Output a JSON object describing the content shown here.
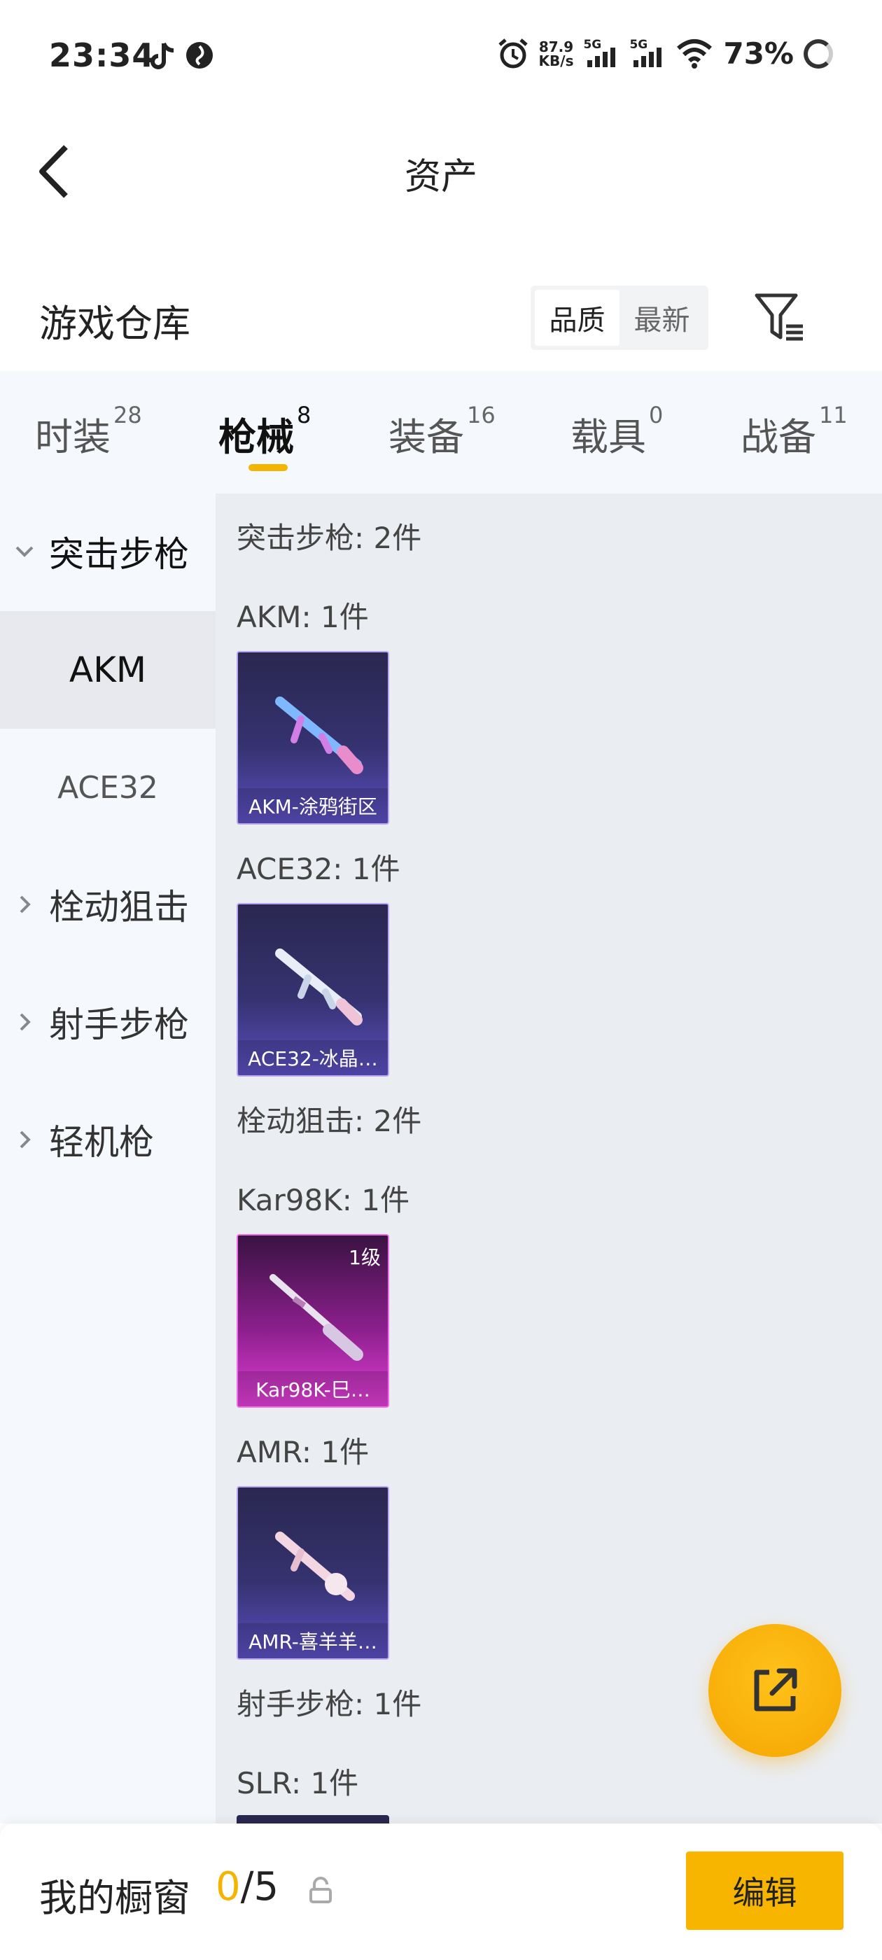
{
  "status_bar": {
    "time": "23:34",
    "left_icons": [
      "tiktok-icon",
      "app-icon"
    ],
    "net_speed_value": "87.9",
    "net_speed_unit": "KB/s",
    "signal1_tag": "5G",
    "signal2_tag": "5G",
    "battery": "73%"
  },
  "header": {
    "title": "资产"
  },
  "warehouse": {
    "title": "游戏仓库",
    "sort_options": [
      "品质",
      "最新"
    ],
    "active_sort": "品质"
  },
  "tabs": [
    {
      "label": "时装",
      "count": "28"
    },
    {
      "label": "枪械",
      "count": "8",
      "active": true
    },
    {
      "label": "装备",
      "count": "16"
    },
    {
      "label": "载具",
      "count": "0"
    },
    {
      "label": "战备",
      "count": "11"
    }
  ],
  "sidebar": {
    "categories": [
      {
        "label": "突击步枪",
        "expanded": true
      },
      {
        "label": "栓动狙击"
      },
      {
        "label": "射手步枪"
      },
      {
        "label": "轻机枪"
      }
    ],
    "subcategories": [
      {
        "label": "AKM",
        "selected": true
      },
      {
        "label": "ACE32"
      }
    ]
  },
  "content": {
    "sections": [
      {
        "title": "突击步枪: 2件",
        "groups": [
          {
            "title": "AKM: 1件",
            "items": [
              {
                "name": "AKM-涂鸦街区",
                "rarity": "purple"
              }
            ]
          },
          {
            "title": "ACE32: 1件",
            "items": [
              {
                "name": "ACE32-冰晶…",
                "rarity": "purple"
              }
            ]
          }
        ]
      },
      {
        "title": "栓动狙击: 2件",
        "groups": [
          {
            "title": "Kar98K: 1件",
            "items": [
              {
                "name": "Kar98K-巳…",
                "rarity": "pink",
                "level": "1级"
              }
            ]
          },
          {
            "title": "AMR: 1件",
            "items": [
              {
                "name": "AMR-喜羊羊…",
                "rarity": "purple"
              }
            ]
          }
        ]
      },
      {
        "title": "射手步枪: 1件",
        "groups": [
          {
            "title": "SLR: 1件",
            "items": []
          }
        ]
      }
    ]
  },
  "fab": {
    "icon": "share-icon"
  },
  "bottom_bar": {
    "showcase_label": "我的橱窗",
    "showcase_used": "0",
    "showcase_total": "/5",
    "edit_label": "编辑"
  },
  "colors": {
    "accent": "#f5b400",
    "content_bg": "#eaedf1",
    "sidebar_bg": "#f5f8fc",
    "card_purple": "#353270",
    "card_pink": "#8c1f8d"
  }
}
